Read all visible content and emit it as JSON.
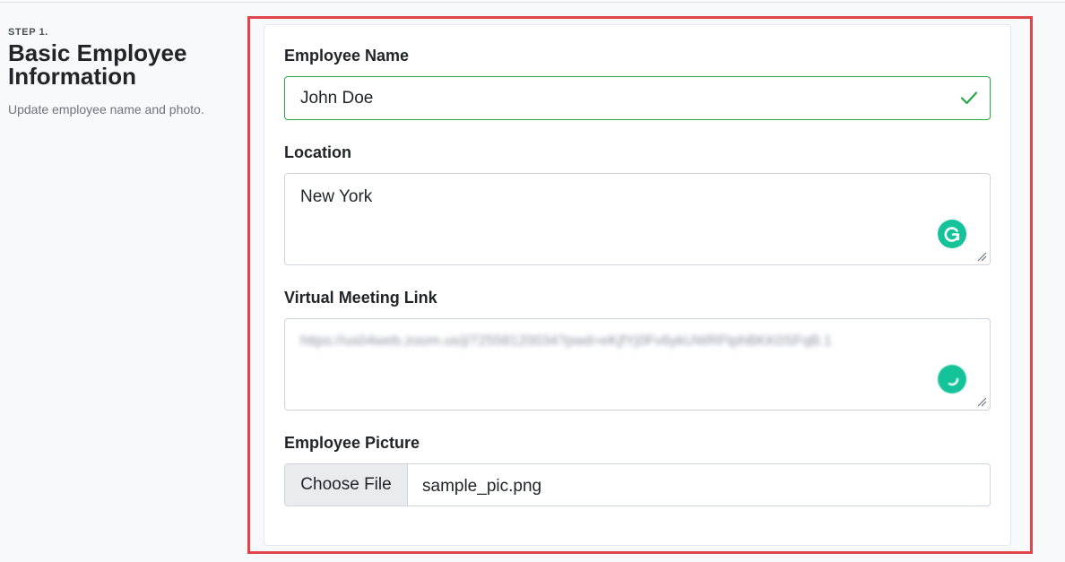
{
  "intro": {
    "step": "STEP 1.",
    "title_line1": "Basic Employee",
    "title_line2": "Information",
    "subtitle": "Update employee name and photo."
  },
  "form": {
    "employee_name": {
      "label": "Employee Name",
      "value": "John Doe",
      "status_icon": "check-icon"
    },
    "location": {
      "label": "Location",
      "value": "New York"
    },
    "meeting_link": {
      "label": "Virtual Meeting Link",
      "value": "https://us04web.zoom.us/j/72558120034?pwd=eKjfYj0Fv6ykUWRFtphBKK0SFqB.1"
    },
    "picture": {
      "label": "Employee Picture",
      "button_label": "Choose File",
      "file_name": "sample_pic.png"
    }
  },
  "colors": {
    "valid": "#28a745",
    "highlight": "#e0454b",
    "grammarly": "#15c39a"
  }
}
